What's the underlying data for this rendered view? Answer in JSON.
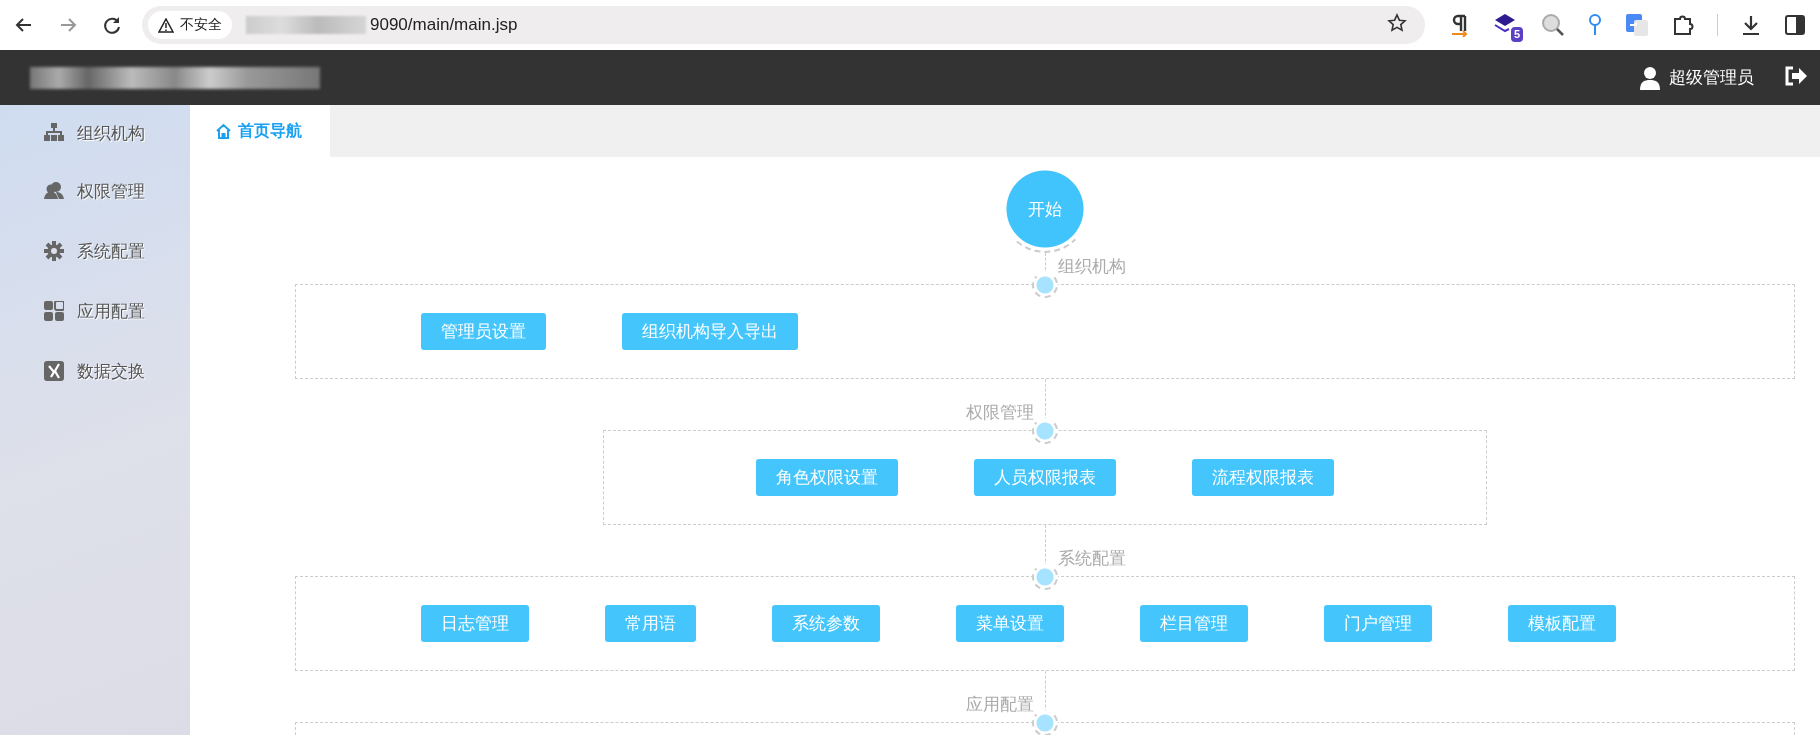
{
  "browser": {
    "security_label": "不安全",
    "url": "9090/main/main.jsp",
    "extension_badge": "5"
  },
  "header": {
    "user_name": "超级管理员"
  },
  "sidebar": {
    "items": [
      {
        "label": "组织机构",
        "kind": "org"
      },
      {
        "label": "权限管理",
        "kind": "users"
      },
      {
        "label": "系统配置",
        "kind": "gear"
      },
      {
        "label": "应用配置",
        "kind": "grid"
      },
      {
        "label": "数据交换",
        "kind": "exchange"
      }
    ]
  },
  "tabs": [
    {
      "label": "首页导航",
      "selected": true
    }
  ],
  "flow": {
    "start": "开始",
    "sections": [
      {
        "title": "组织机构",
        "kind": "wide",
        "buttons": [
          "管理员设置",
          "组织机构导入导出"
        ]
      },
      {
        "title": "权限管理",
        "kind": "narrow",
        "buttons": [
          "角色权限设置",
          "人员权限报表",
          "流程权限报表"
        ]
      },
      {
        "title": "系统配置",
        "kind": "wide",
        "buttons": [
          "日志管理",
          "常用语",
          "系统参数",
          "菜单设置",
          "栏目管理",
          "门户管理",
          "模板配置"
        ]
      },
      {
        "title": "应用配置",
        "kind": "wide"
      }
    ]
  }
}
